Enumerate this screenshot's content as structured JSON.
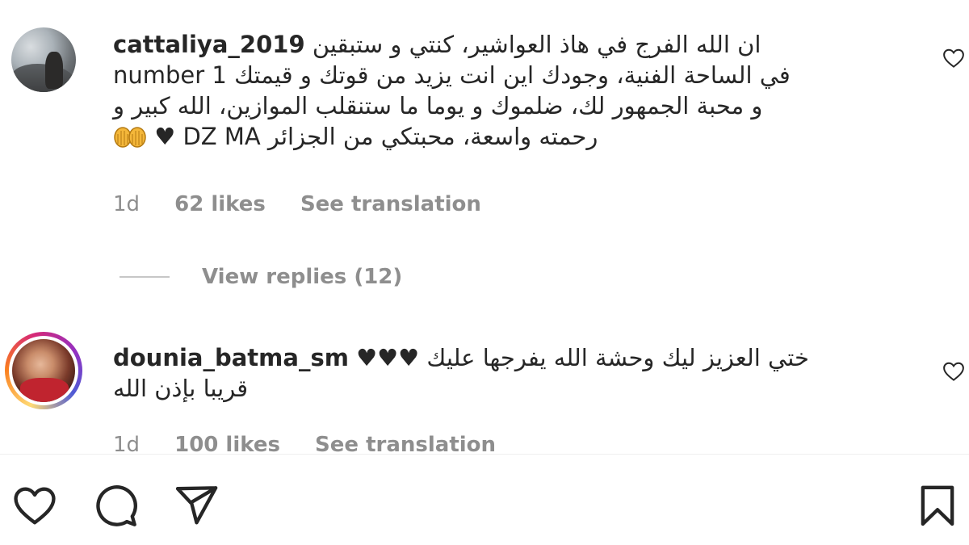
{
  "comments": [
    {
      "username": "cattaliya_2019",
      "lines": [
        "ان الله الفرج في هاذ العواشير، كنتي و ستبقين",
        "number 1 في الساحة الفنية، وجودك اين انت يزيد من قوتك و قيمتك",
        "و محبة الجمهور لك، ضلموك و يوما ما ستنقلب الموازين، الله كبير و",
        "رحمته واسعة، محبتكي من الجزائر DZ MA ♥"
      ],
      "time": "1d",
      "likes": "62 likes",
      "translate": "See translation",
      "view_replies": "View replies (12)"
    },
    {
      "username": "dounia_batma_sm",
      "lines": [
        "ختي العزيز ليك وحشة الله يفرجها عليك ♥♥♥",
        "قريبا بإذن الله"
      ],
      "time": "1d",
      "likes": "100 likes",
      "translate": "See translation"
    }
  ],
  "icons": {
    "like": "heart-outline-icon",
    "comment": "speech-bubble-icon",
    "share": "paper-plane-icon",
    "save": "bookmark-icon"
  }
}
